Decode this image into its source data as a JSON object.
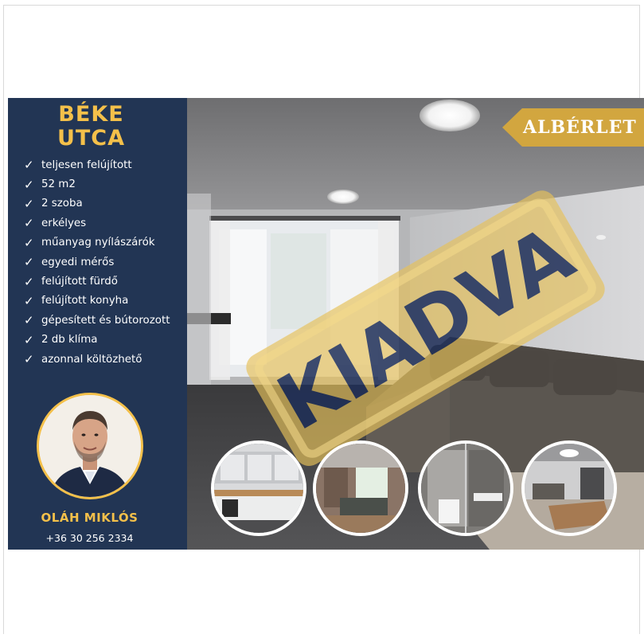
{
  "listing": {
    "title_line1": "BÉKE",
    "title_line2": "UTCA",
    "features": [
      "teljesen felújított",
      "52 m2",
      "2 szoba",
      "erkélyes",
      "műanyag nyílászárók",
      "egyedi mérős",
      "felújított fürdő",
      "felújított konyha",
      "gépesített és bútorozott",
      "2 db klíma",
      "azonnal költözhető"
    ],
    "tag": "ALBÉRLET",
    "stamp": "KIADVA"
  },
  "agent": {
    "name": "OLÁH MIKLÓS",
    "phone": "+36 30 256 2334"
  },
  "colors": {
    "panel_bg": "#223554",
    "accent_gold": "#d2a63f",
    "title_gold": "#f4c04a",
    "stamp_gold": "#e7c25a",
    "stamp_text": "#1f2f58"
  },
  "icons": [
    "check-icon",
    "agent-portrait",
    "ceiling-lamp-icon"
  ]
}
